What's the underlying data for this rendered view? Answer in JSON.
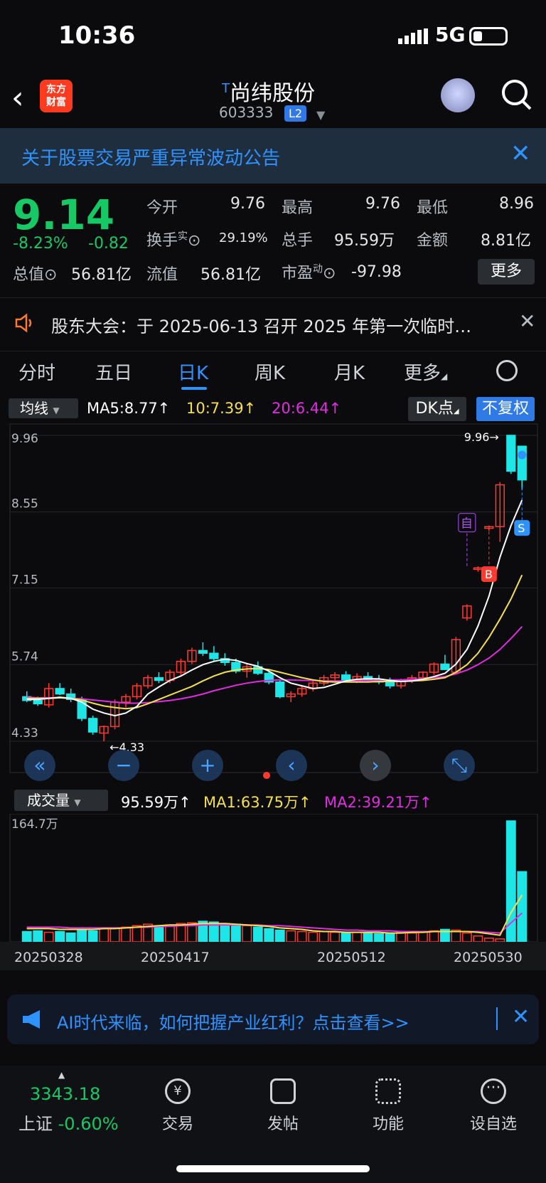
{
  "status_bar": {
    "time": "10:36",
    "network": "5G"
  },
  "header": {
    "logo_line1": "东方",
    "logo_line2": "财富",
    "title_prefix": "T",
    "title": "尚纬股份",
    "code": "603333",
    "level_badge": "L2"
  },
  "announcement": {
    "text": "关于股票交易严重异常波动公告"
  },
  "quote": {
    "price": "9.14",
    "change_pct": "-8.23%",
    "change": "-0.82",
    "open_label": "今开",
    "open": "9.76",
    "high_label": "最高",
    "high": "9.76",
    "low_label": "最低",
    "low": "8.96",
    "turnover_label": "换手",
    "turnover_sup": "实",
    "turnover": "29.19%",
    "volume_label": "总手",
    "volume": "95.59万",
    "amount_label": "金额",
    "amount": "8.81亿",
    "total_value_label": "总值",
    "total_value": "56.81亿",
    "float_value_label": "流值",
    "float_value": "56.81亿",
    "pe_label": "市盈",
    "pe_sup": "动",
    "pe": "-97.98",
    "more_button": "更多"
  },
  "notice": {
    "text": "股东大会：于 2025-06-13 召开 2025 年第一次临时…"
  },
  "tabs": [
    "分时",
    "五日",
    "日K",
    "周K",
    "月K",
    "更多"
  ],
  "ma_bar": {
    "select_label": "均线",
    "ma5": "MA5:8.77↑",
    "ma10": "10:7.39↑",
    "ma20": "20:6.44↑",
    "dk_label": "DK点",
    "adjust_label": "不复权"
  },
  "volume_bar": {
    "select_label": "成交量",
    "vol": "95.59万↑",
    "ma1": "MA1:63.75万↑",
    "ma2": "MA2:39.21万↑"
  },
  "ad": {
    "text": "AI时代来临，如何把握产业红利？点击查看>>"
  },
  "bottom_nav": {
    "index_value": "3343.18",
    "index_name": "上证",
    "index_change": "-0.60%",
    "trade": "交易",
    "post": "发帖",
    "function": "功能",
    "watchlist": "设自选"
  },
  "colors": {
    "up": "#ff3b30",
    "down": "#1fe6e6",
    "ma5": "#ffffff",
    "ma10": "#f4e04d",
    "ma20": "#e12de1",
    "accent": "#2e93ff"
  },
  "chart_data": {
    "type": "candlestick",
    "price_ylim": [
      4.33,
      9.96
    ],
    "price_ticks": [
      "9.96",
      "8.55",
      "7.15",
      "5.74",
      "4.33"
    ],
    "high_mark": "9.96",
    "low_mark": "4.33",
    "markers": {
      "self": "自",
      "buy": "B",
      "sell": "S"
    },
    "volume_max_label": "164.7万",
    "volume_ylim": [
      0,
      164.7
    ],
    "dates": [
      "20250328",
      "20250417",
      "20250512",
      "20250530"
    ],
    "ohlc": [
      [
        5.15,
        5.25,
        5.05,
        5.08
      ],
      [
        5.08,
        5.15,
        4.98,
        5.02
      ],
      [
        5.0,
        5.4,
        4.95,
        5.3
      ],
      [
        5.3,
        5.4,
        5.18,
        5.2
      ],
      [
        5.2,
        5.3,
        5.05,
        5.1
      ],
      [
        5.1,
        5.15,
        4.7,
        4.75
      ],
      [
        4.75,
        4.8,
        4.45,
        4.5
      ],
      [
        4.48,
        4.62,
        4.33,
        4.6
      ],
      [
        4.6,
        5.1,
        4.55,
        5.05
      ],
      [
        5.05,
        5.2,
        4.95,
        5.15
      ],
      [
        5.15,
        5.4,
        5.1,
        5.35
      ],
      [
        5.35,
        5.55,
        5.3,
        5.5
      ],
      [
        5.5,
        5.6,
        5.4,
        5.45
      ],
      [
        5.45,
        5.65,
        5.4,
        5.6
      ],
      [
        5.6,
        5.85,
        5.55,
        5.8
      ],
      [
        5.8,
        6.05,
        5.75,
        6.0
      ],
      [
        6.0,
        6.15,
        5.9,
        5.95
      ],
      [
        5.95,
        6.08,
        5.8,
        5.85
      ],
      [
        5.85,
        5.95,
        5.72,
        5.78
      ],
      [
        5.78,
        5.85,
        5.58,
        5.62
      ],
      [
        5.62,
        5.75,
        5.5,
        5.7
      ],
      [
        5.7,
        5.8,
        5.55,
        5.58
      ],
      [
        5.58,
        5.65,
        5.38,
        5.42
      ],
      [
        5.42,
        5.45,
        5.12,
        5.15
      ],
      [
        5.15,
        5.25,
        5.05,
        5.2
      ],
      [
        5.2,
        5.35,
        5.15,
        5.3
      ],
      [
        5.3,
        5.45,
        5.25,
        5.4
      ],
      [
        5.4,
        5.55,
        5.35,
        5.5
      ],
      [
        5.5,
        5.6,
        5.45,
        5.55
      ],
      [
        5.55,
        5.62,
        5.42,
        5.45
      ],
      [
        5.45,
        5.58,
        5.4,
        5.52
      ],
      [
        5.52,
        5.6,
        5.42,
        5.47
      ],
      [
        5.47,
        5.55,
        5.38,
        5.42
      ],
      [
        5.42,
        5.5,
        5.3,
        5.35
      ],
      [
        5.35,
        5.48,
        5.3,
        5.45
      ],
      [
        5.45,
        5.55,
        5.4,
        5.5
      ],
      [
        5.5,
        5.62,
        5.45,
        5.6
      ],
      [
        5.6,
        5.78,
        5.55,
        5.75
      ],
      [
        5.75,
        5.92,
        5.7,
        5.65
      ],
      [
        5.6,
        6.25,
        5.58,
        6.2
      ],
      [
        6.6,
        6.85,
        6.55,
        6.82
      ],
      [
        7.5,
        7.55,
        7.45,
        7.52
      ],
      [
        8.25,
        8.3,
        8.2,
        8.28
      ],
      [
        8.28,
        9.1,
        8.0,
        9.05
      ],
      [
        9.96,
        9.96,
        9.25,
        9.3
      ],
      [
        9.76,
        9.76,
        8.96,
        9.14
      ]
    ],
    "ma5": [
      5.1,
      5.1,
      5.12,
      5.14,
      5.12,
      5.05,
      4.92,
      4.85,
      4.8,
      4.85,
      4.97,
      5.2,
      5.33,
      5.45,
      5.53,
      5.64,
      5.74,
      5.8,
      5.84,
      5.82,
      5.76,
      5.71,
      5.62,
      5.5,
      5.4,
      5.35,
      5.3,
      5.32,
      5.38,
      5.44,
      5.47,
      5.48,
      5.48,
      5.45,
      5.43,
      5.44,
      5.47,
      5.52,
      5.58,
      5.75,
      6.02,
      6.45,
      7.0,
      7.72,
      8.3,
      8.77
    ],
    "ma10": [
      5.12,
      5.12,
      5.12,
      5.13,
      5.12,
      5.09,
      5.03,
      4.98,
      4.95,
      4.93,
      4.95,
      5.02,
      5.1,
      5.18,
      5.26,
      5.34,
      5.44,
      5.53,
      5.6,
      5.64,
      5.66,
      5.67,
      5.65,
      5.6,
      5.55,
      5.5,
      5.46,
      5.43,
      5.42,
      5.42,
      5.42,
      5.42,
      5.43,
      5.43,
      5.43,
      5.44,
      5.45,
      5.47,
      5.5,
      5.6,
      5.74,
      5.95,
      6.24,
      6.58,
      6.95,
      7.39
    ],
    "ma20": [
      5.14,
      5.13,
      5.13,
      5.13,
      5.12,
      5.11,
      5.09,
      5.07,
      5.05,
      5.03,
      5.03,
      5.04,
      5.06,
      5.08,
      5.11,
      5.15,
      5.2,
      5.26,
      5.31,
      5.36,
      5.4,
      5.43,
      5.45,
      5.46,
      5.46,
      5.45,
      5.45,
      5.44,
      5.44,
      5.44,
      5.44,
      5.45,
      5.45,
      5.46,
      5.46,
      5.47,
      5.48,
      5.5,
      5.52,
      5.57,
      5.64,
      5.74,
      5.86,
      6.02,
      6.22,
      6.44
    ],
    "volume": [
      14,
      15,
      13,
      14,
      12,
      16,
      15,
      18,
      19,
      20,
      22,
      24,
      21,
      23,
      25,
      26,
      28,
      27,
      25,
      24,
      22,
      20,
      18,
      16,
      15,
      14,
      13,
      14,
      13,
      12,
      13,
      12,
      11,
      12,
      13,
      12,
      14,
      15,
      17,
      16,
      12,
      8,
      5,
      4,
      164.7,
      95.59
    ],
    "vol_ma1": [
      18,
      18,
      18,
      17,
      17,
      17,
      17,
      18,
      18,
      19,
      20,
      21,
      22,
      23,
      23,
      24,
      25,
      25,
      25,
      24,
      23,
      22,
      21,
      19,
      18,
      17,
      15,
      14,
      14,
      13,
      13,
      13,
      13,
      12,
      12,
      13,
      13,
      14,
      14,
      14,
      14,
      13,
      11,
      9,
      40,
      63.75
    ],
    "vol_ma2": [
      20,
      20,
      20,
      20,
      19,
      19,
      19,
      19,
      19,
      19,
      20,
      20,
      21,
      21,
      22,
      22,
      23,
      23,
      23,
      23,
      23,
      23,
      22,
      22,
      21,
      20,
      19,
      18,
      17,
      16,
      16,
      15,
      15,
      15,
      14,
      14,
      14,
      14,
      14,
      14,
      14,
      14,
      13,
      12,
      26,
      39.21
    ]
  }
}
